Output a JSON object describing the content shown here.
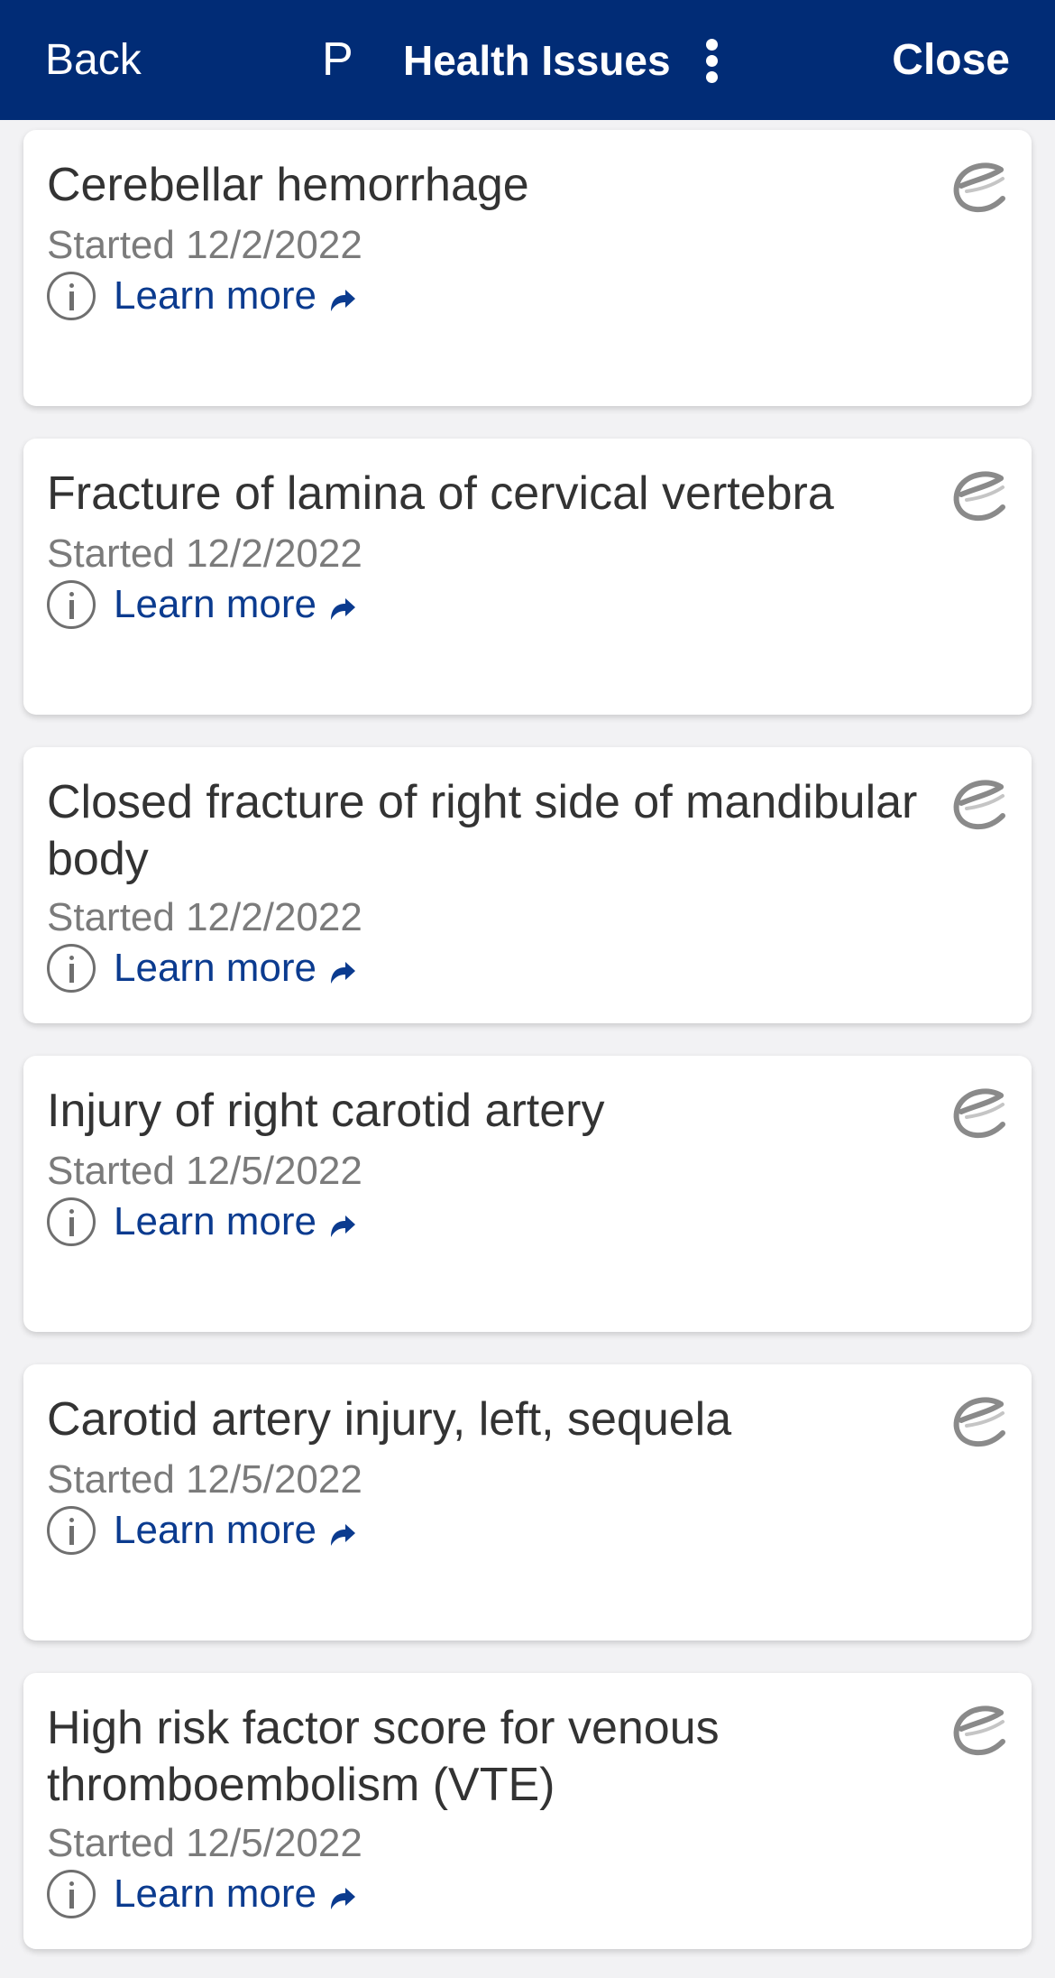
{
  "header": {
    "back_label": "Back",
    "avatar_initial": "P",
    "title": "Health Issues",
    "close_label": "Close",
    "more_icon": "kebab-menu-icon",
    "background_color": "#012c76"
  },
  "issues": [
    {
      "name": "Cerebellar hemorrhage",
      "started": "Started 12/2/2022",
      "learn_more": "Learn more"
    },
    {
      "name": "Fracture of lamina of cervical vertebra",
      "started": "Started 12/2/2022",
      "learn_more": "Learn more"
    },
    {
      "name": "Closed fracture of right side of mandibular body",
      "started": "Started 12/2/2022",
      "learn_more": "Learn more"
    },
    {
      "name": "Injury of right carotid artery",
      "started": "Started 12/5/2022",
      "learn_more": "Learn more"
    },
    {
      "name": "Carotid artery injury, left, sequela",
      "started": "Started 12/5/2022",
      "learn_more": "Learn more"
    },
    {
      "name": "High risk factor score for venous thromboembolism (VTE)",
      "started": "Started 12/5/2022",
      "learn_more": "Learn more"
    }
  ],
  "icons": {
    "info": "info-icon",
    "external_link": "external-link-icon",
    "source": "epic-logo-icon"
  },
  "colors": {
    "link": "#0b3b8f",
    "secondary_text": "#7b7b7b",
    "primary_text": "#333333"
  }
}
